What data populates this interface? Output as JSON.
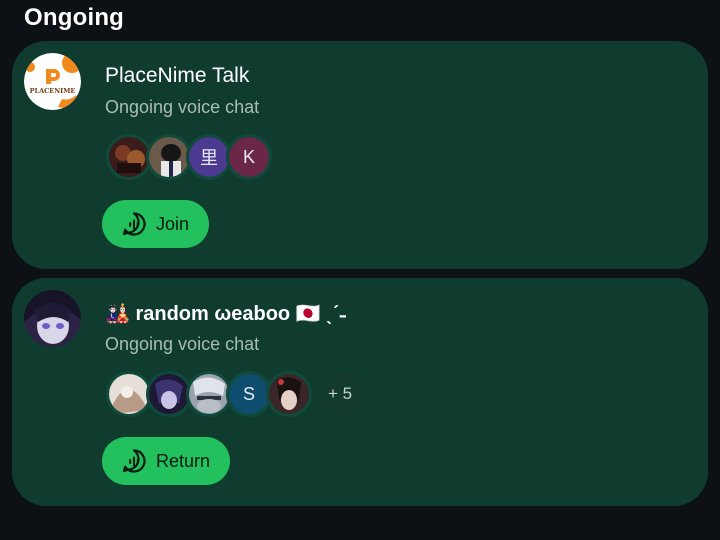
{
  "section": {
    "title": "Ongoing"
  },
  "rooms": [
    {
      "name": "PlaceNime Talk",
      "status": "Ongoing voice chat",
      "avatar_icon": "placenime-logo",
      "avatar_text": "PLACENIME",
      "participants": [
        {
          "initial": "",
          "icon": "user-photo-avatar"
        },
        {
          "initial": "",
          "icon": "user-photo-avatar"
        },
        {
          "initial": "里",
          "color": "#4b3a8f"
        },
        {
          "initial": "K",
          "color": "#6a2748"
        }
      ],
      "action_label": "Join",
      "action_icon": "voice-chat-icon"
    },
    {
      "name": "🎎 random ωeaboo 🇯🇵 ˎˊ˗",
      "status": "Ongoing voice chat",
      "avatar_icon": "anime-avatar",
      "participants": [
        {
          "initial": "",
          "icon": "user-photo-avatar"
        },
        {
          "initial": "",
          "icon": "user-photo-avatar"
        },
        {
          "initial": "",
          "icon": "user-photo-avatar"
        },
        {
          "initial": "S",
          "color": "#0f4d6e"
        },
        {
          "initial": "",
          "icon": "user-photo-avatar"
        }
      ],
      "more_count": "+ 5",
      "action_label": "Return",
      "action_icon": "voice-chat-icon"
    }
  ],
  "colors": {
    "background": "#0d1116",
    "card": "#103c2f",
    "accent": "#22c15e",
    "muted_text": "#a9bdb5"
  }
}
